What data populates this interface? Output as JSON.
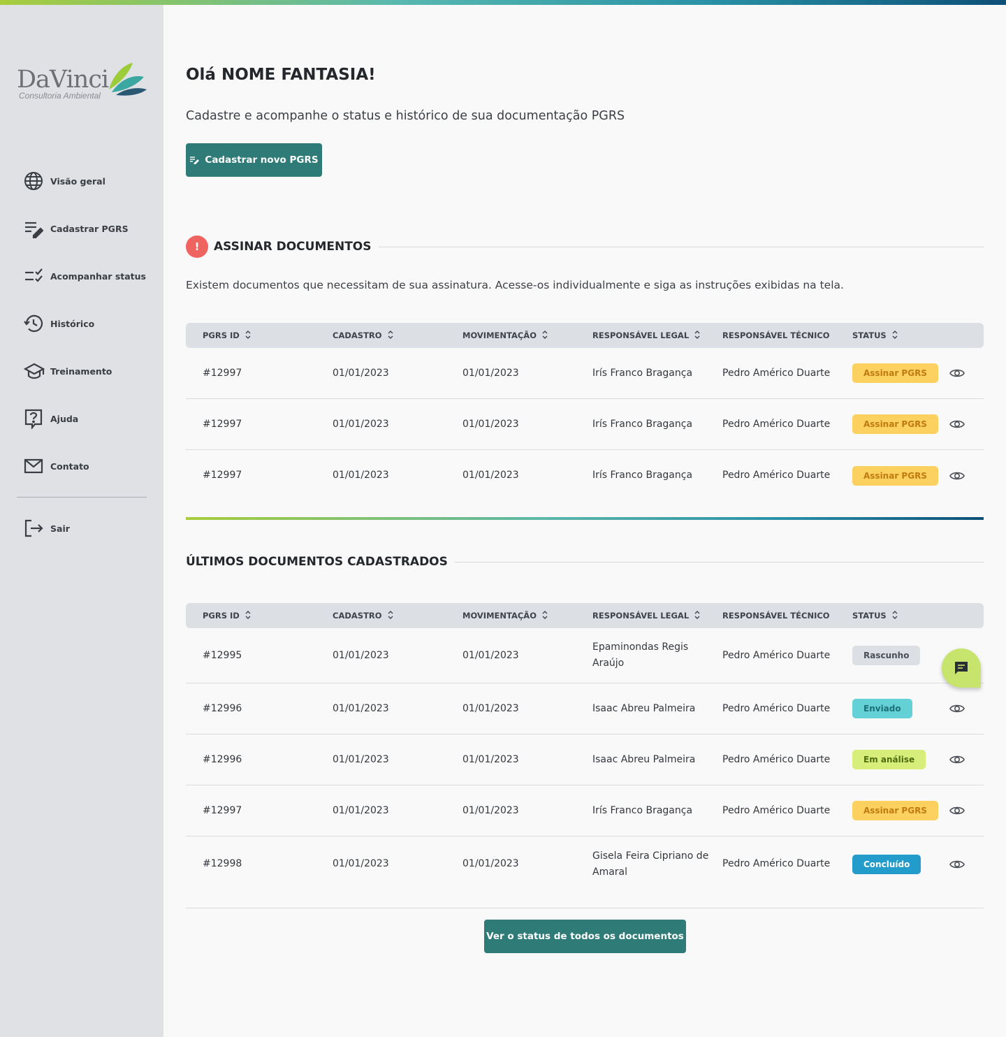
{
  "brand": {
    "name": "DaVinci",
    "tagline": "Consultoria Ambiental"
  },
  "colors": {
    "primary": "#2e7b78",
    "sidebar_bg": "#dfe1e5",
    "alert": "#ef6461",
    "status_assinar": "#fdd160",
    "status_rascunho": "#dcdfe4",
    "status_enviado": "#63d1d5",
    "status_analise": "#d7ef7a",
    "status_concluido": "#239ccb"
  },
  "sidebar": {
    "items": [
      {
        "label": "Visão geral",
        "icon": "globe-icon"
      },
      {
        "label": "Cadastrar PGRS",
        "icon": "edit-list-icon"
      },
      {
        "label": "Acompanhar status",
        "icon": "checklist-icon"
      },
      {
        "label": "Histórico",
        "icon": "history-icon"
      },
      {
        "label": "Treinamento",
        "icon": "graduation-cap-icon"
      },
      {
        "label": "Ajuda",
        "icon": "help-icon"
      },
      {
        "label": "Contato",
        "icon": "mail-icon"
      }
    ],
    "logout": {
      "label": "Sair",
      "icon": "logout-icon"
    }
  },
  "header": {
    "greeting": "Olá NOME FANTASIA!",
    "subtitle": "Cadastre e acompanhe o status e histórico de sua documentação PGRS",
    "new_button": "Cadastrar novo PGRS"
  },
  "columns": [
    "PGRS ID",
    "CADASTRO",
    "MOVIMENTAÇÃO",
    "RESPONSÁVEL LEGAL",
    "RESPONSÁVEL TÉCNICO",
    "STATUS"
  ],
  "sign_section": {
    "title": "ASSINAR DOCUMENTOS",
    "alert_symbol": "!",
    "description": "Existem documentos que necessitam de sua assinatura. Acesse-os individualmente e siga as instruções exibidas na tela.",
    "rows": [
      {
        "id": "#12997",
        "cadastro": "01/01/2023",
        "movimentacao": "01/01/2023",
        "legal": "Irís Franco Bragança",
        "tecnico": "Pedro Américo Duarte",
        "status": "Assinar PGRS",
        "status_key": "assinar"
      },
      {
        "id": "#12997",
        "cadastro": "01/01/2023",
        "movimentacao": "01/01/2023",
        "legal": "Irís Franco Bragança",
        "tecnico": "Pedro Américo Duarte",
        "status": "Assinar PGRS",
        "status_key": "assinar"
      },
      {
        "id": "#12997",
        "cadastro": "01/01/2023",
        "movimentacao": "01/01/2023",
        "legal": "Irís Franco Bragança",
        "tecnico": "Pedro Américo Duarte",
        "status": "Assinar PGRS",
        "status_key": "assinar"
      }
    ]
  },
  "latest_section": {
    "title": "ÚLTIMOS DOCUMENTOS CADASTRADOS",
    "rows": [
      {
        "id": "#12995",
        "cadastro": "01/01/2023",
        "movimentacao": "01/01/2023",
        "legal": "Epaminondas Regis Araújo",
        "tecnico": "Pedro Américo Duarte",
        "status": "Rascunho",
        "status_key": "rascunho"
      },
      {
        "id": "#12996",
        "cadastro": "01/01/2023",
        "movimentacao": "01/01/2023",
        "legal": "Isaac Abreu Palmeira",
        "tecnico": "Pedro Américo Duarte",
        "status": "Enviado",
        "status_key": "enviado"
      },
      {
        "id": "#12996",
        "cadastro": "01/01/2023",
        "movimentacao": "01/01/2023",
        "legal": "Isaac Abreu Palmeira",
        "tecnico": "Pedro Américo Duarte",
        "status": "Em análise",
        "status_key": "analise"
      },
      {
        "id": "#12997",
        "cadastro": "01/01/2023",
        "movimentacao": "01/01/2023",
        "legal": "Irís Franco Bragança",
        "tecnico": "Pedro Américo Duarte",
        "status": "Assinar PGRS",
        "status_key": "assinar"
      },
      {
        "id": "#12998",
        "cadastro": "01/01/2023",
        "movimentacao": "01/01/2023",
        "legal": "Gisela Feira Cipriano de Amaral",
        "tecnico": "Pedro Américo Duarte",
        "status": "Concluído",
        "status_key": "concluido"
      }
    ],
    "view_all_button": "Ver o status de todos os documentos"
  },
  "chat": {
    "icon": "chat-icon"
  }
}
